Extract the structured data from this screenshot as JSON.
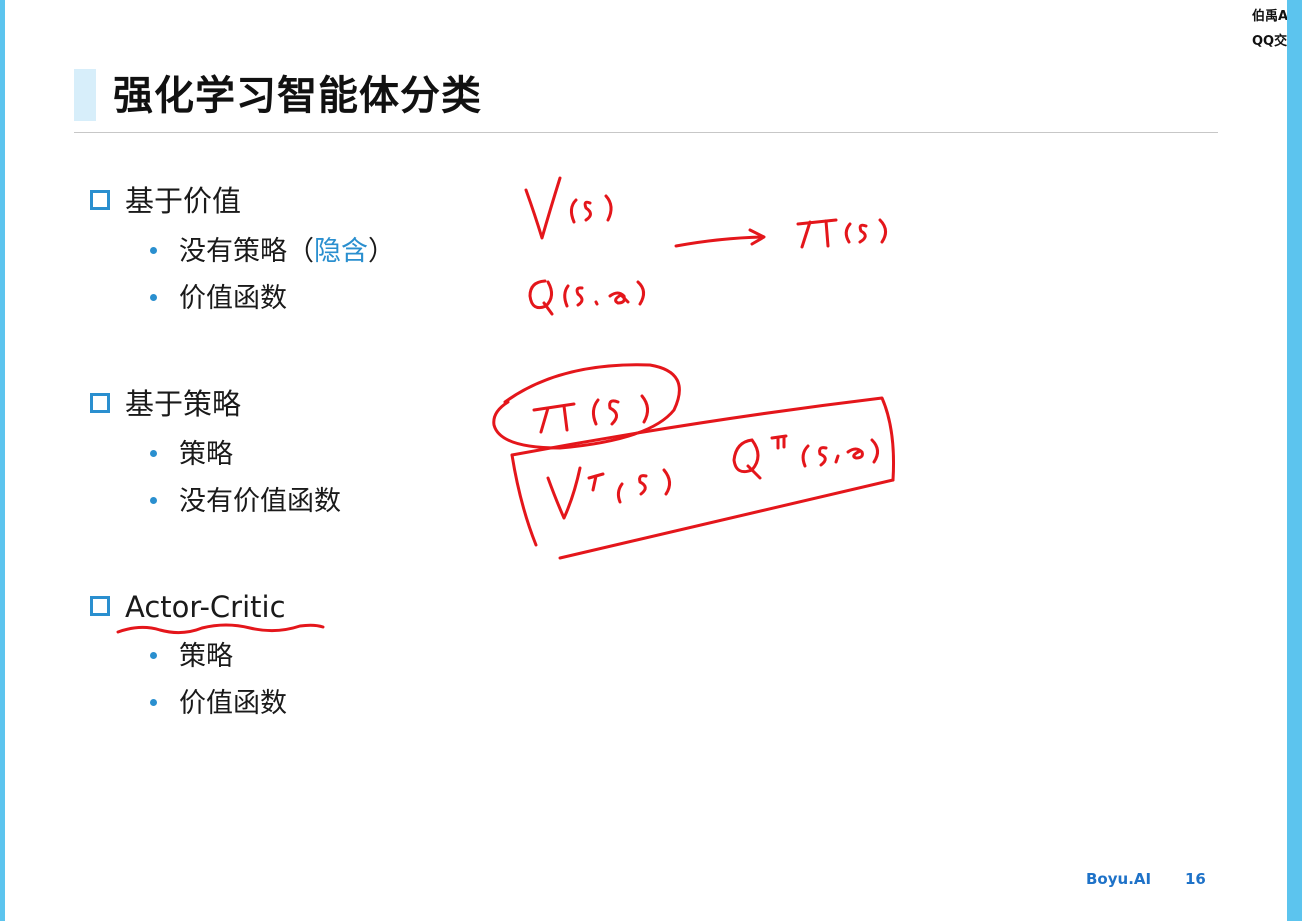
{
  "corner": {
    "line1": "伯禹AI",
    "line2": "QQ交流群"
  },
  "slide": {
    "title": "强化学习智能体分类",
    "sections": [
      {
        "heading": "基于价值",
        "bullets": [
          "没有策略（",
          "隐含",
          "）",
          "价值函数"
        ]
      },
      {
        "heading": "基于策略",
        "bullets": [
          "策略",
          "没有价值函数"
        ]
      },
      {
        "heading": "Actor-Critic",
        "bullets": [
          "策略",
          "价值函数"
        ]
      }
    ]
  },
  "footer": {
    "brand": "Boyu.AI",
    "page": "16"
  },
  "colors": {
    "accent": "#2a8fcf",
    "ink": "#e4161b",
    "frame": "#5cc4ee"
  }
}
